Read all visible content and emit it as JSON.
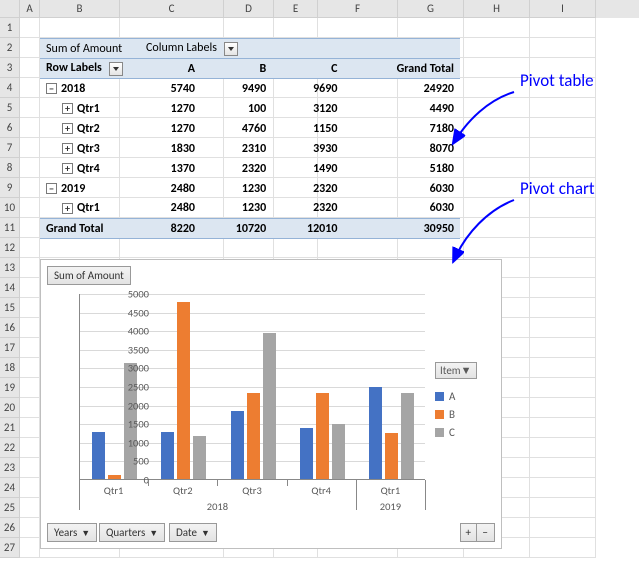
{
  "columns": [
    "",
    "A",
    "B",
    "C",
    "D",
    "E",
    "F",
    "G",
    "H",
    "I"
  ],
  "rows": [
    "1",
    "2",
    "3",
    "4",
    "5",
    "6",
    "7",
    "8",
    "9",
    "10",
    "11",
    "12",
    "13",
    "14",
    "15",
    "16",
    "17",
    "18",
    "19",
    "20",
    "21",
    "22",
    "23",
    "24",
    "25",
    "26",
    "27"
  ],
  "pivot": {
    "measure": "Sum of Amount",
    "col_label_hdr": "Column Labels",
    "row_label_hdr": "Row Labels",
    "cols": [
      "A",
      "B",
      "C",
      "Grand Total"
    ],
    "rows_data": [
      {
        "type": "year",
        "label": "2018",
        "vals": [
          5740,
          9490,
          9690,
          24920
        ]
      },
      {
        "type": "qtr",
        "label": "Qtr1",
        "vals": [
          1270,
          100,
          3120,
          4490
        ]
      },
      {
        "type": "qtr",
        "label": "Qtr2",
        "vals": [
          1270,
          4760,
          1150,
          7180
        ]
      },
      {
        "type": "qtr",
        "label": "Qtr3",
        "vals": [
          1830,
          2310,
          3930,
          8070
        ]
      },
      {
        "type": "qtr",
        "label": "Qtr4",
        "vals": [
          1370,
          2320,
          1490,
          5180
        ]
      },
      {
        "type": "year",
        "label": "2019",
        "vals": [
          2480,
          1230,
          2320,
          6030
        ]
      },
      {
        "type": "qtr",
        "label": "Qtr1",
        "vals": [
          2480,
          1230,
          2320,
          6030
        ]
      }
    ],
    "grand": {
      "label": "Grand Total",
      "vals": [
        8220,
        10720,
        12010,
        30950
      ]
    }
  },
  "chart_data": {
    "type": "bar",
    "title_button": "Sum of Amount",
    "legend_title": "Item",
    "ylim": [
      0,
      5000
    ],
    "ystep": 500,
    "groups": [
      {
        "parent": "2018",
        "label": "Qtr1",
        "A": 1270,
        "B": 100,
        "C": 3120
      },
      {
        "parent": "2018",
        "label": "Qtr2",
        "A": 1270,
        "B": 4760,
        "C": 1150
      },
      {
        "parent": "2018",
        "label": "Qtr3",
        "A": 1830,
        "B": 2310,
        "C": 3930
      },
      {
        "parent": "2018",
        "label": "Qtr4",
        "A": 1370,
        "B": 2320,
        "C": 1490
      },
      {
        "parent": "2019",
        "label": "Qtr1",
        "A": 2480,
        "B": 1230,
        "C": 2320
      }
    ],
    "series": [
      {
        "name": "A",
        "color": "#4472C4"
      },
      {
        "name": "B",
        "color": "#ED7D31"
      },
      {
        "name": "C",
        "color": "#A5A5A5"
      }
    ],
    "bottom_buttons": [
      "Years",
      "Quarters",
      "Date"
    ]
  },
  "annotations": {
    "table": "Pivot table",
    "chart": "Pivot chart"
  }
}
